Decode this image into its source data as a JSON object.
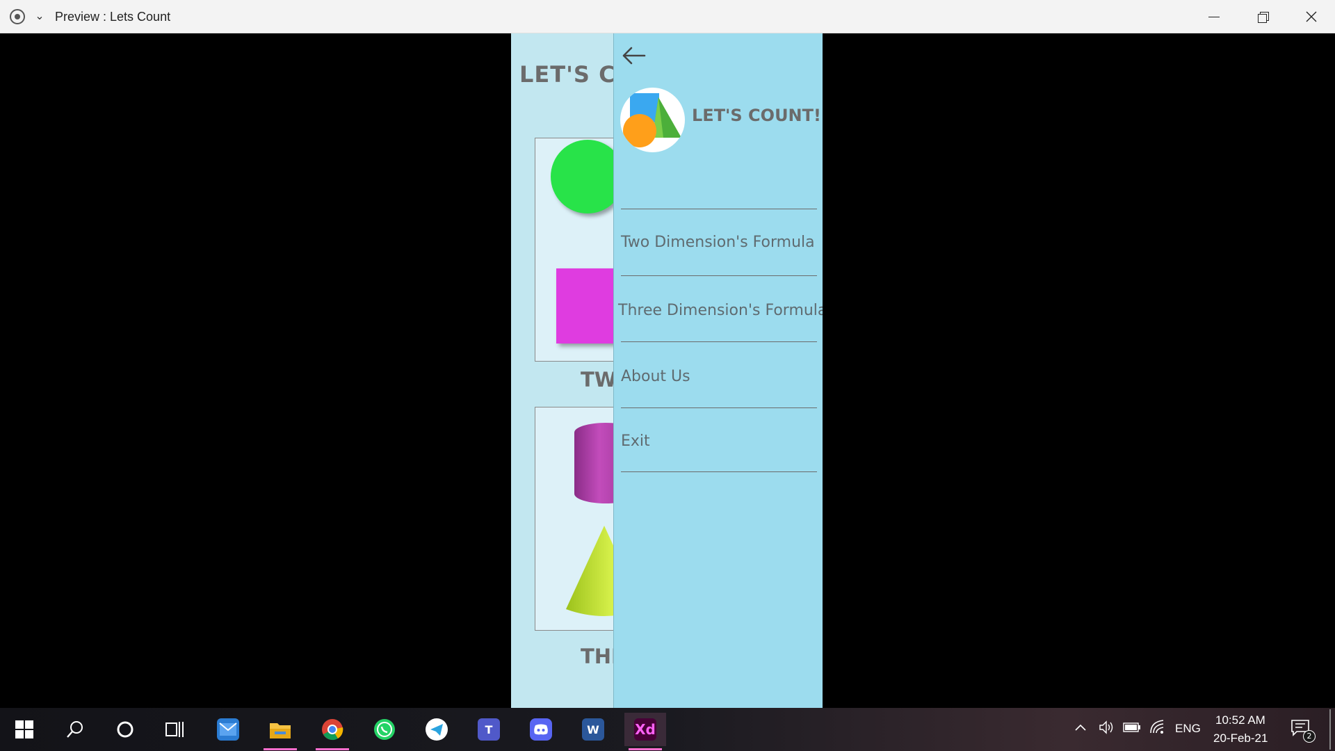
{
  "window": {
    "title": "Preview : Lets Count",
    "record_icon": "record-icon",
    "dropdown_icon": "chevron-down-icon",
    "controls": [
      "minimize-icon",
      "maximize-icon",
      "close-icon"
    ]
  },
  "app": {
    "title": "LET'S COUNT!",
    "cards": [
      {
        "label": "TWO DIMENSION",
        "shapes": [
          "circle",
          "square"
        ]
      },
      {
        "label": "THREE DIMENSION",
        "shapes": [
          "cylinder",
          "cone"
        ]
      }
    ],
    "colors": {
      "background": "#c2e7f0",
      "card": "#ddf1f8",
      "circle": "#28e349",
      "square": "#df3ce0"
    }
  },
  "drawer": {
    "back_icon": "arrow-left-icon",
    "title": "LET'S COUNT!",
    "menu": [
      {
        "label": "Two Dimension's Formula"
      },
      {
        "label": "Three Dimension's Formula"
      },
      {
        "label": "About Us"
      },
      {
        "label": "Exit"
      }
    ],
    "color": "#9cdcee"
  },
  "taskbar": {
    "apps": [
      "start-icon",
      "search-icon",
      "cortana-icon",
      "task-view-icon",
      "mail-icon",
      "file-explorer-icon",
      "chrome-icon",
      "whatsapp-icon",
      "telegram-icon",
      "teams-icon",
      "discord-icon",
      "word-icon",
      "adobe-xd-icon"
    ],
    "tray": {
      "language": "ENG",
      "time": "10:52 AM",
      "date": "20-Feb-21",
      "notification_count": "2"
    }
  }
}
